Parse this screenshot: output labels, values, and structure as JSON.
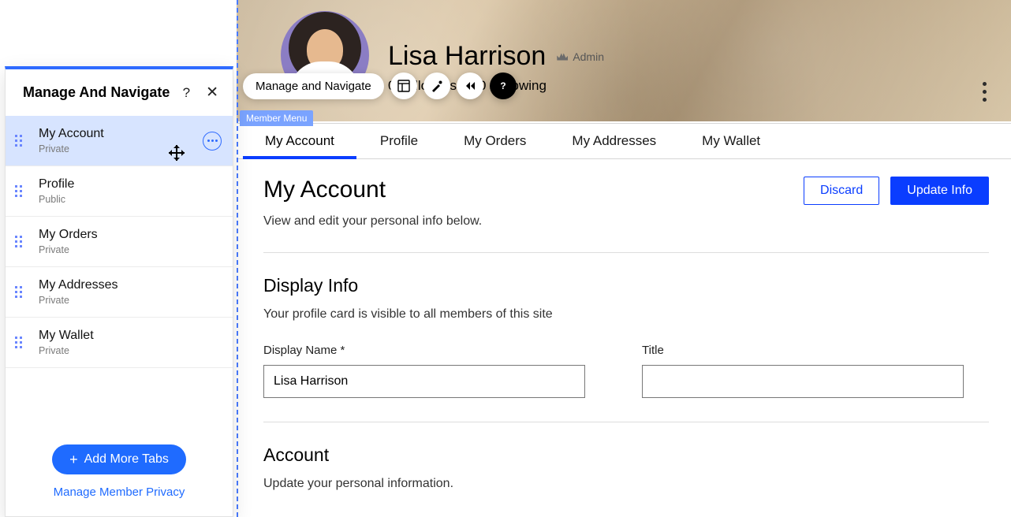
{
  "panel": {
    "title": "Manage And Navigate",
    "help_glyph": "?",
    "close_glyph": "✕",
    "items": [
      {
        "name": "My Account",
        "visibility": "Private",
        "active": true,
        "show_more": true
      },
      {
        "name": "Profile",
        "visibility": "Public",
        "active": false,
        "show_more": false
      },
      {
        "name": "My Orders",
        "visibility": "Private",
        "active": false,
        "show_more": false
      },
      {
        "name": "My Addresses",
        "visibility": "Private",
        "active": false,
        "show_more": false
      },
      {
        "name": "My Wallet",
        "visibility": "Private",
        "active": false,
        "show_more": false
      }
    ],
    "add_tabs_label": "Add More Tabs",
    "manage_privacy_label": "Manage Member Privacy"
  },
  "toolbar": {
    "pill_label": "Manage and Navigate"
  },
  "profile": {
    "display_name": "Lisa Harrison",
    "role": "Admin",
    "followers_label": "Followers",
    "following_label": "Following",
    "followers": 0,
    "following": 0
  },
  "member_menu_tag": "Member Menu",
  "tabs": [
    {
      "label": "My Account",
      "active": true
    },
    {
      "label": "Profile",
      "active": false
    },
    {
      "label": "My Orders",
      "active": false
    },
    {
      "label": "My Addresses",
      "active": false
    },
    {
      "label": "My Wallet",
      "active": false
    }
  ],
  "page": {
    "title": "My Account",
    "subtitle": "View and edit your personal info below.",
    "discard": "Discard",
    "update": "Update Info",
    "display_info_title": "Display Info",
    "display_info_sub": "Your profile card is visible to all members of this site",
    "display_name_label": "Display Name *",
    "display_name_value": "Lisa Harrison",
    "title_label": "Title",
    "title_value": "",
    "account_title": "Account",
    "account_sub": "Update your personal information."
  }
}
